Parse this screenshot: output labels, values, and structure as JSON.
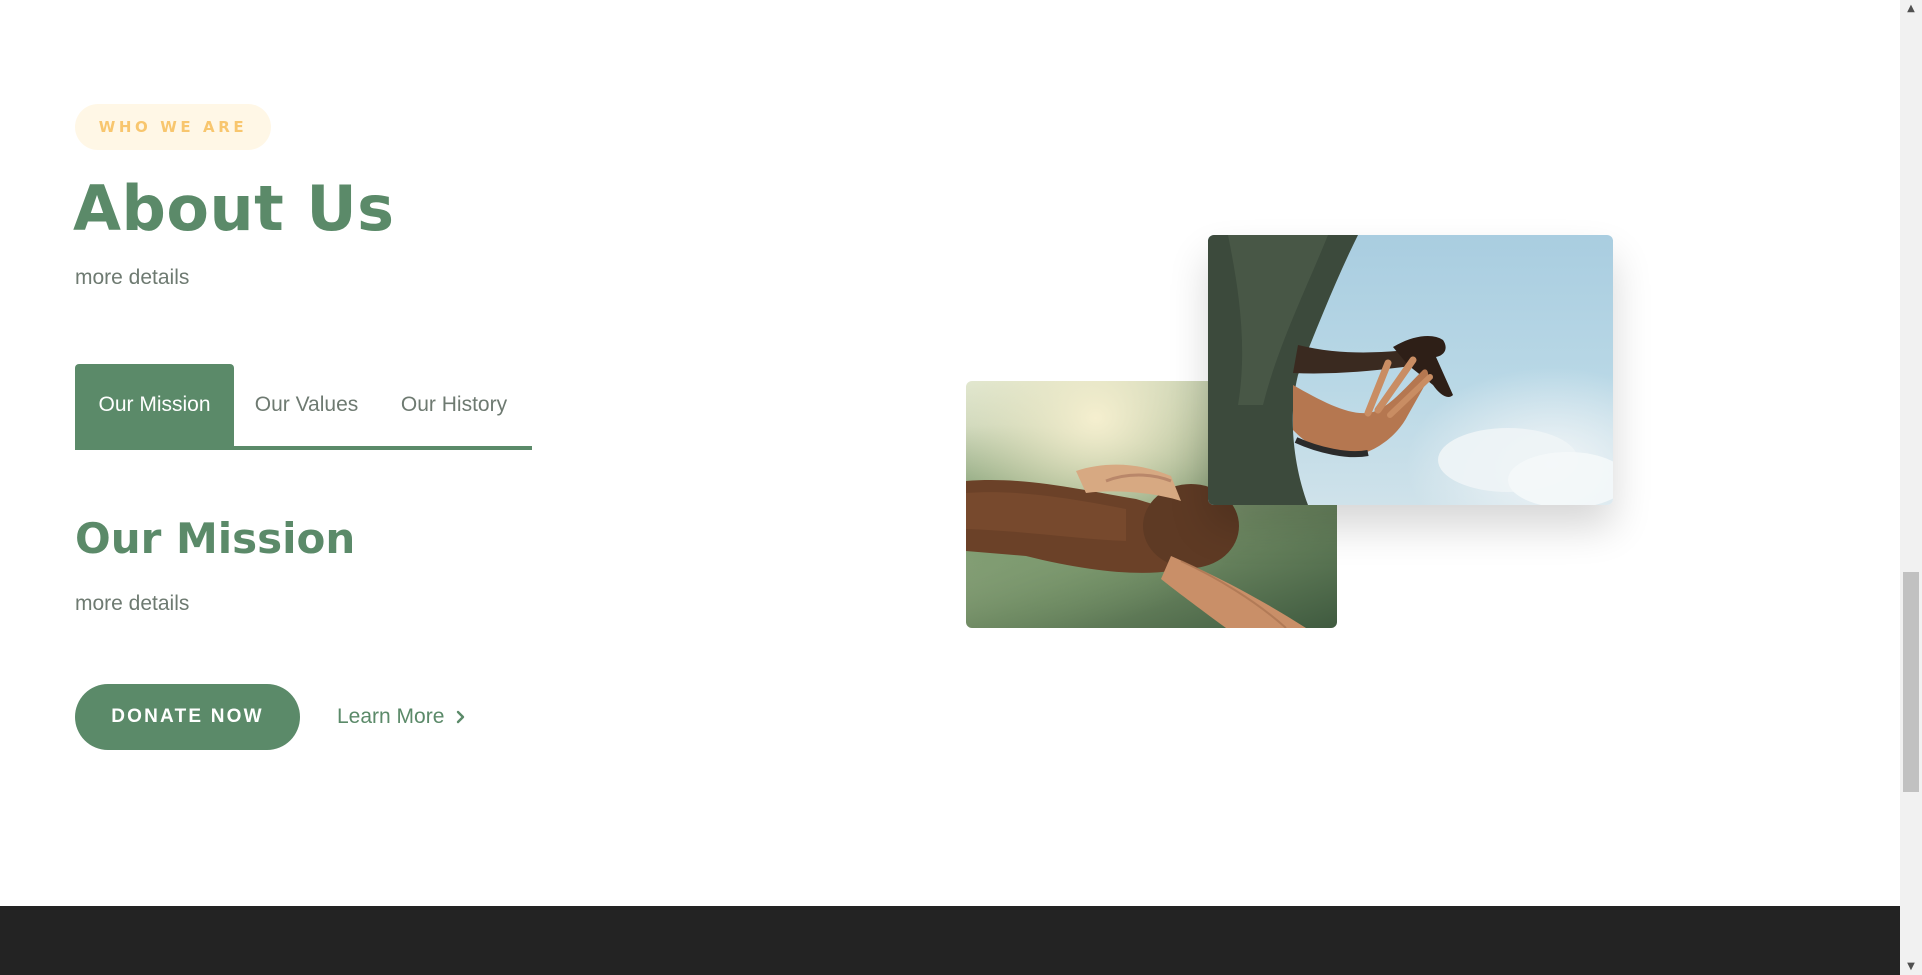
{
  "about": {
    "eyebrow": "WHO WE ARE",
    "title": "About Us",
    "subtitle": "more details"
  },
  "tabs": [
    {
      "label": "Our Mission",
      "active": true
    },
    {
      "label": "Our Values",
      "active": false
    },
    {
      "label": "Our History",
      "active": false
    }
  ],
  "panel": {
    "title": "Our Mission",
    "text": "more details"
  },
  "actions": {
    "donate_label": "DONATE NOW",
    "learn_more_label": "Learn More",
    "learn_more_icon": "chevron-right-icon"
  },
  "images": {
    "back": "handshake-photo",
    "front": "reaching-hands-photo"
  },
  "colors": {
    "brand_green": "#5b8a69",
    "eyebrow_text": "#f8c66e",
    "eyebrow_bg": "#fff7e6",
    "body_text": "#6e7a71",
    "footer_bg": "#232323"
  }
}
